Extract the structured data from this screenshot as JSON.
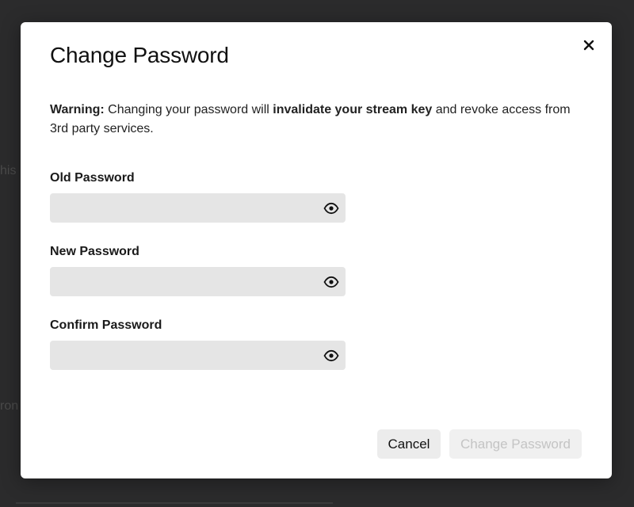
{
  "background": {
    "snippets": [
      "his",
      "ron"
    ]
  },
  "modal": {
    "title": "Change Password",
    "close_icon": "close-icon",
    "warning": {
      "prefix": "Warning:",
      "part1": " Changing your password will ",
      "emphasis": "invalidate your stream key",
      "part2": " and revoke access from 3rd party services."
    },
    "fields": [
      {
        "label": "Old Password",
        "value": "",
        "placeholder": "",
        "icon": "eye-icon"
      },
      {
        "label": "New Password",
        "value": "",
        "placeholder": "",
        "icon": "eye-icon"
      },
      {
        "label": "Confirm Password",
        "value": "",
        "placeholder": "",
        "icon": "eye-icon"
      }
    ],
    "buttons": {
      "cancel": "Cancel",
      "submit": "Change Password"
    }
  },
  "colors": {
    "backdrop": "#2b2b2c",
    "modal_bg": "#ffffff",
    "field_bg": "#e5e5e5",
    "disabled_text": "#c4c4c4"
  }
}
